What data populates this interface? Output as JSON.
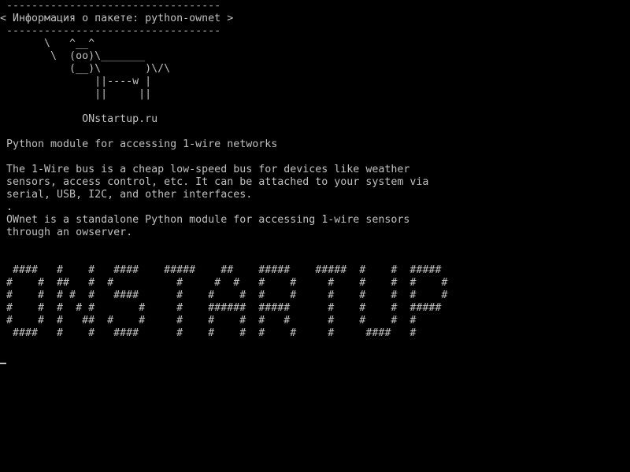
{
  "terminal": {
    "lines": [
      " ----------------------------------",
      "< Информация о пакете: python-ownet >",
      " ----------------------------------",
      "       \\   ^__^",
      "        \\  (oo)\\_______",
      "           (__)\\       )\\/\\",
      "               ||----w |",
      "               ||     ||",
      "",
      "             ONstartup.ru",
      "",
      " Python module for accessing 1-wire networks",
      "",
      " The 1-Wire bus is a cheap low-speed bus for devices like weather",
      " sensors, access control, etc. It can be attached to your system via",
      " serial, USB, I2C, and other interfaces.",
      " .",
      " OWnet is a standalone Python module for accessing 1-wire sensors",
      " through an owserver.",
      "",
      "",
      "  ####   #    #   ####    #####    ##    #####    #####  #    #  #####",
      " #    #  ##   #  #          #     #  #   #    #     #    #    #  #    #",
      " #    #  # #  #   ####      #    #    #  #    #     #    #    #  #    #",
      " #    #  #  # #       #     #    ######  #####      #    #    #  #####",
      " #    #  #   ##  #    #     #    #    #  #   #      #    #    #  #",
      "  ####   #    #   ####      #    #    #  #    #     #     ####   #"
    ],
    "colors": {
      "background": "#000000",
      "foreground": "#c0c0c0"
    }
  }
}
